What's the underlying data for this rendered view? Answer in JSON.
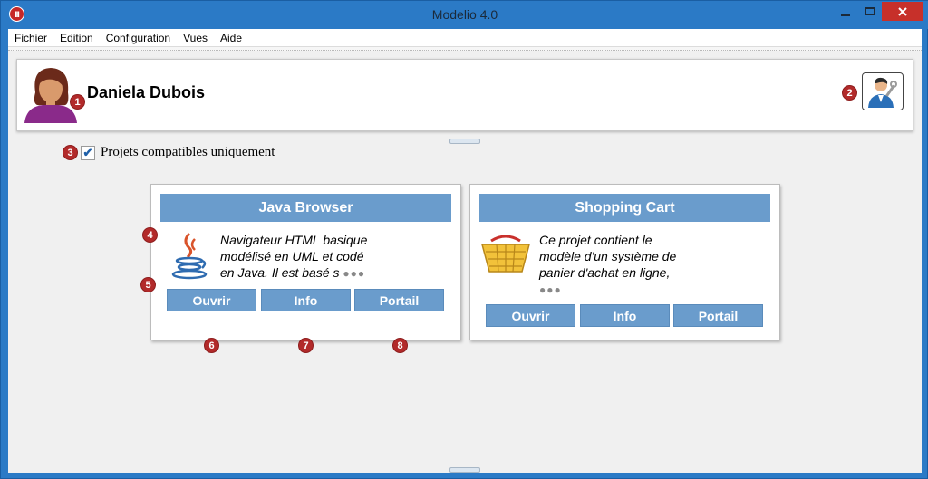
{
  "window": {
    "title": "Modelio 4.0",
    "app_icon_text": "III",
    "minimize_icon": "minimize-icon",
    "maximize_icon": "maximize-icon",
    "close_icon": "close-icon"
  },
  "menu": [
    "Fichier",
    "Edition",
    "Configuration",
    "Vues",
    "Aide"
  ],
  "user": {
    "name": "Daniela Dubois",
    "avatar_icon": "user-avatar-icon",
    "settings_icon": "user-settings-icon"
  },
  "filter": {
    "label": "Projets compatibles uniquement",
    "checked": true
  },
  "badges": [
    "1",
    "2",
    "3",
    "4",
    "5",
    "6",
    "7",
    "8"
  ],
  "projects": [
    {
      "title": "Java Browser",
      "icon": "java-icon",
      "desc_lines": [
        "Navigateur HTML basique",
        "modélisé en UML et codé",
        "en Java. Il est basé s"
      ],
      "more": "●●●",
      "buttons": [
        "Ouvrir",
        "Info",
        "Portail"
      ]
    },
    {
      "title": "Shopping Cart",
      "icon": "shopping-basket-icon",
      "desc_lines": [
        "Ce projet contient le",
        "modèle d'un système de",
        "panier d'achat en ligne,"
      ],
      "more": "●●●",
      "buttons": [
        "Ouvrir",
        "Info",
        "Portail"
      ]
    }
  ],
  "colors": {
    "accent": "#6a9ccc",
    "badge": "#b22a2a",
    "titlebar": "#2b7ac6",
    "close": "#c7302a"
  }
}
